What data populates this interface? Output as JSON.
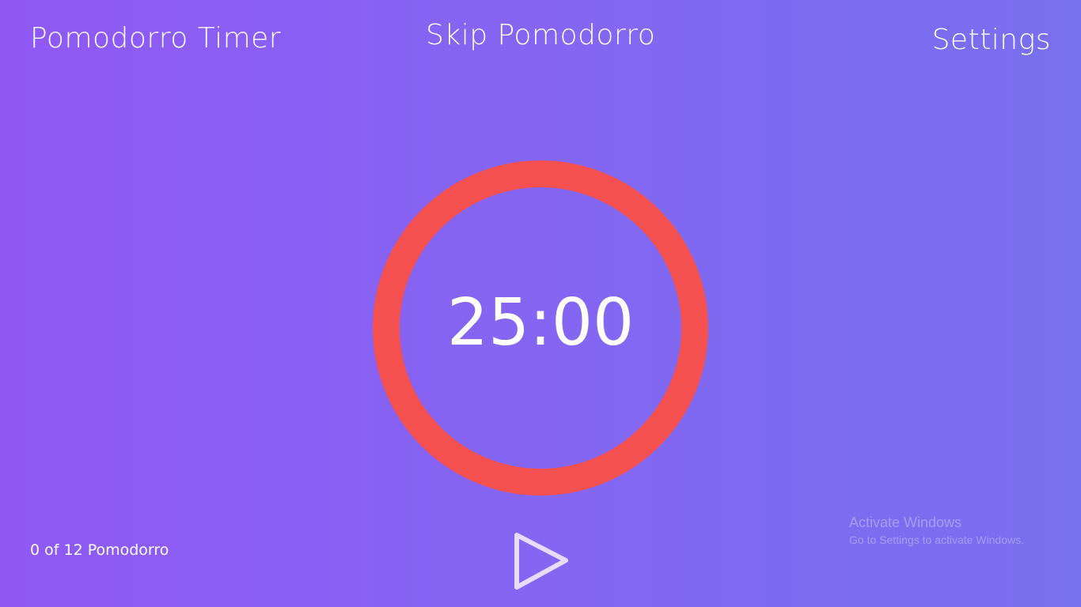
{
  "header": {
    "app_title": "Pomodorro Timer",
    "skip_label": "Skip Pomodorro",
    "settings_label": "Settings"
  },
  "timer": {
    "display": "25:00",
    "ring_color": "#f55050",
    "progress": 1.0
  },
  "footer": {
    "counter_text": "0 of 12 Pomodorro",
    "play_icon": "play-icon"
  },
  "watermark": {
    "title": "Activate Windows",
    "subtitle": "Go to Settings to activate Windows."
  },
  "colors": {
    "background_start": "#8f58f4",
    "background_end": "#7770ef",
    "text": "#ffffff"
  }
}
